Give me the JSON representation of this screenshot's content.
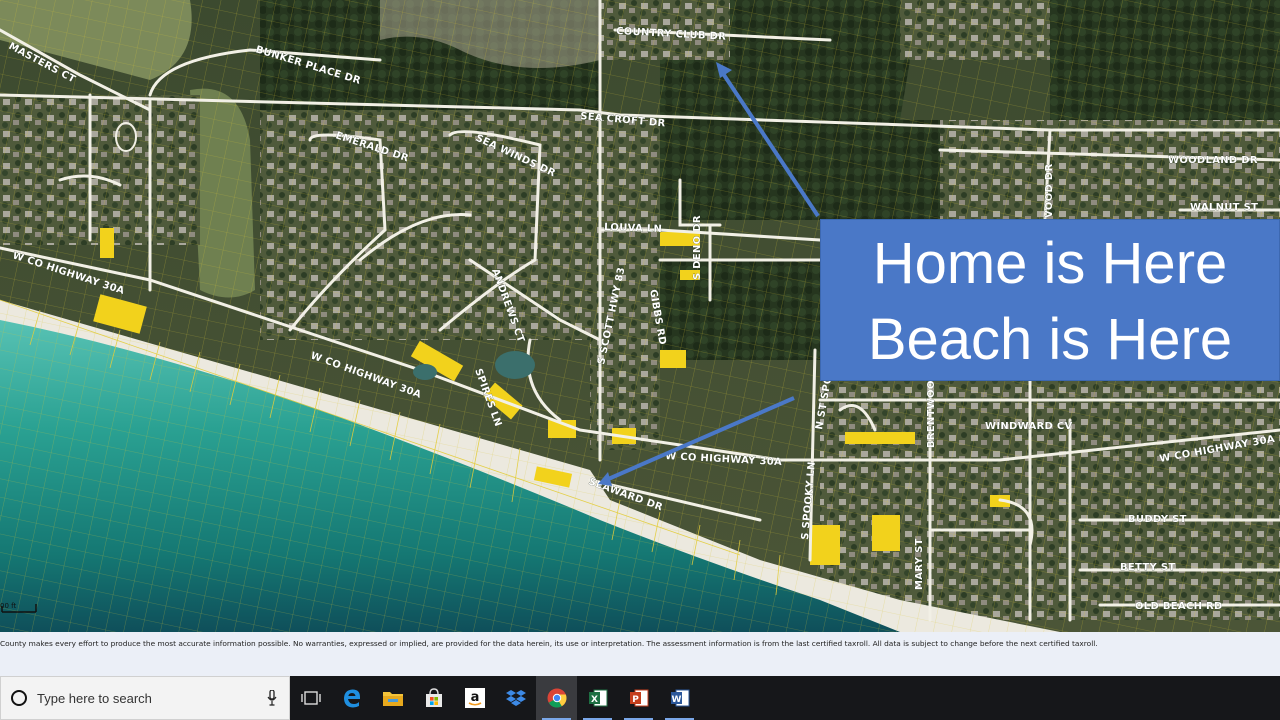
{
  "map": {
    "road_labels": [
      "COUNTRY CLUB DR",
      "BUNKER PLACE DR",
      "MASTERS CT",
      "SEA CROFT DR",
      "EMERALD DR",
      "SEA WINDS DR",
      "WOODLAND DR",
      "WALNUT ST",
      "LOUVA LN",
      "S DENO DR",
      "W CO HIGHWAY 30A",
      "W CO HIGHWAY 30A",
      "W CO HIGHWAY 30A",
      "ANDREWS CT",
      "S SCOTT HWY 83",
      "GIBBS RD",
      "SPIRES LN",
      "N ST SPOOKY LN",
      "BRENTWOOD",
      "WINDWARD CV",
      "W CO HIGHWAY 30A",
      "SEAWARD DR",
      "S SPOOKY LN",
      "MARY ST",
      "BUDDY ST",
      "BETTY ST",
      "OLD BEACH RD",
      "VOOD DR"
    ],
    "scale_label": "00 ft"
  },
  "callout": {
    "line1": "Home is Here",
    "line2": "Beach is Here"
  },
  "disclaimer": "County makes every effort to produce the most accurate information possible. No warranties, expressed or implied, are provided for the data herein, its use or interpretation. The assessment information is from the last certified taxroll. All data is subject to change before the next certified taxroll.",
  "taskbar": {
    "search_placeholder": "Type here to search",
    "apps": [
      "Task View",
      "Microsoft Edge",
      "File Explorer",
      "Microsoft Store",
      "Amazon",
      "Dropbox",
      "Google Chrome",
      "Microsoft Excel",
      "Microsoft PowerPoint",
      "Microsoft Word"
    ]
  },
  "colors": {
    "callout": "#4a78c7",
    "parcel_lines": "#e8d23a",
    "roads": "#f2f0e6",
    "ocean": "#1f8c86",
    "sand": "#ece9df",
    "forest": "#24361f",
    "taskbar": "#16171a"
  }
}
